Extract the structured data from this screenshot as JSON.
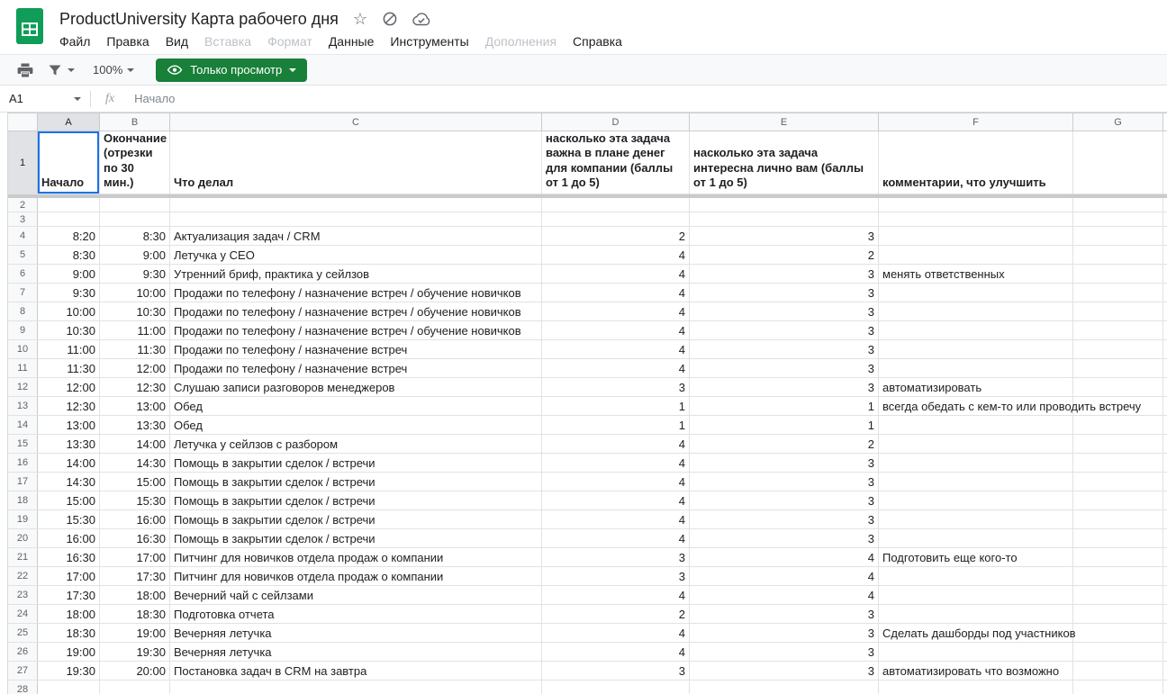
{
  "titlebar": {
    "title": "ProductUniversity Карта рабочего дня"
  },
  "glyphs": {
    "star": "☆"
  },
  "menus": [
    {
      "id": "file",
      "label": "Файл",
      "enabled": true
    },
    {
      "id": "edit",
      "label": "Правка",
      "enabled": true
    },
    {
      "id": "view",
      "label": "Вид",
      "enabled": true
    },
    {
      "id": "insert",
      "label": "Вставка",
      "enabled": false
    },
    {
      "id": "format",
      "label": "Формат",
      "enabled": false
    },
    {
      "id": "data",
      "label": "Данные",
      "enabled": true
    },
    {
      "id": "tools",
      "label": "Инструменты",
      "enabled": true
    },
    {
      "id": "addons",
      "label": "Дополнения",
      "enabled": false
    },
    {
      "id": "help",
      "label": "Справка",
      "enabled": true
    }
  ],
  "toolbar": {
    "zoom": "100%",
    "view_only": "Только просмотр"
  },
  "formula_bar": {
    "cell_ref": "A1",
    "fx_label": "fx",
    "value": "Начало"
  },
  "grid": {
    "column_letters": [
      "A",
      "B",
      "C",
      "D",
      "E",
      "F",
      "G"
    ],
    "selected_cell": "A1",
    "header_row": {
      "n": "1",
      "a": "Начало",
      "b": "Окончание (отрезки по 30 мин.)",
      "c": "Что делал",
      "d": "насколько эта задача важна в плане денег для компании (баллы от 1 до 5)",
      "e": "насколько эта задача интересна лично вам (баллы от 1 до 5)",
      "f": "комментарии, что улучшить",
      "g": ""
    },
    "rows": [
      {
        "n": "2",
        "a": "",
        "b": "",
        "c": "",
        "d": "",
        "e": "",
        "f": "",
        "g": ""
      },
      {
        "n": "3",
        "a": "",
        "b": "",
        "c": "",
        "d": "",
        "e": "",
        "f": "",
        "g": ""
      },
      {
        "n": "4",
        "a": "8:20",
        "b": "8:30",
        "c": "Актуализация задач / CRM",
        "d": "2",
        "e": "3",
        "f": "",
        "g": ""
      },
      {
        "n": "5",
        "a": "8:30",
        "b": "9:00",
        "c": "Летучка у CEO",
        "d": "4",
        "e": "2",
        "f": "",
        "g": ""
      },
      {
        "n": "6",
        "a": "9:00",
        "b": "9:30",
        "c": "Утренний бриф, практика у сейлзов",
        "d": "4",
        "e": "3",
        "f": "менять ответственных",
        "g": ""
      },
      {
        "n": "7",
        "a": "9:30",
        "b": "10:00",
        "c": "Продажи по телефону / назначение встреч / обучение новичков",
        "d": "4",
        "e": "3",
        "f": "",
        "g": ""
      },
      {
        "n": "8",
        "a": "10:00",
        "b": "10:30",
        "c": "Продажи по телефону / назначение встреч / обучение новичков",
        "d": "4",
        "e": "3",
        "f": "",
        "g": ""
      },
      {
        "n": "9",
        "a": "10:30",
        "b": "11:00",
        "c": "Продажи по телефону / назначение встреч / обучение новичков",
        "d": "4",
        "e": "3",
        "f": "",
        "g": ""
      },
      {
        "n": "10",
        "a": "11:00",
        "b": "11:30",
        "c": "Продажи по телефону / назначение встреч",
        "d": "4",
        "e": "3",
        "f": "",
        "g": ""
      },
      {
        "n": "11",
        "a": "11:30",
        "b": "12:00",
        "c": "Продажи по телефону / назначение встреч",
        "d": "4",
        "e": "3",
        "f": "",
        "g": ""
      },
      {
        "n": "12",
        "a": "12:00",
        "b": "12:30",
        "c": "Слушаю записи разговоров менеджеров",
        "d": "3",
        "e": "3",
        "f": "автоматизировать",
        "g": ""
      },
      {
        "n": "13",
        "a": "12:30",
        "b": "13:00",
        "c": "Обед",
        "d": "1",
        "e": "1",
        "f": "всегда обедать с кем-то или проводить встречу",
        "g": ""
      },
      {
        "n": "14",
        "a": "13:00",
        "b": "13:30",
        "c": "Обед",
        "d": "1",
        "e": "1",
        "f": "",
        "g": ""
      },
      {
        "n": "15",
        "a": "13:30",
        "b": "14:00",
        "c": "Летучка у сейлзов с разбором",
        "d": "4",
        "e": "2",
        "f": "",
        "g": ""
      },
      {
        "n": "16",
        "a": "14:00",
        "b": "14:30",
        "c": "Помощь в закрытии сделок / встречи",
        "d": "4",
        "e": "3",
        "f": "",
        "g": ""
      },
      {
        "n": "17",
        "a": "14:30",
        "b": "15:00",
        "c": "Помощь в закрытии сделок / встречи",
        "d": "4",
        "e": "3",
        "f": "",
        "g": ""
      },
      {
        "n": "18",
        "a": "15:00",
        "b": "15:30",
        "c": "Помощь в закрытии сделок / встречи",
        "d": "4",
        "e": "3",
        "f": "",
        "g": ""
      },
      {
        "n": "19",
        "a": "15:30",
        "b": "16:00",
        "c": "Помощь в закрытии сделок / встречи",
        "d": "4",
        "e": "3",
        "f": "",
        "g": ""
      },
      {
        "n": "20",
        "a": "16:00",
        "b": "16:30",
        "c": "Помощь в закрытии сделок / встречи",
        "d": "4",
        "e": "3",
        "f": "",
        "g": ""
      },
      {
        "n": "21",
        "a": "16:30",
        "b": "17:00",
        "c": "Питчинг для новичков отдела продаж о компании",
        "d": "3",
        "e": "4",
        "f": "Подготовить еще кого-то",
        "g": ""
      },
      {
        "n": "22",
        "a": "17:00",
        "b": "17:30",
        "c": "Питчинг для новичков отдела продаж о компании",
        "d": "3",
        "e": "4",
        "f": "",
        "g": ""
      },
      {
        "n": "23",
        "a": "17:30",
        "b": "18:00",
        "c": "Вечерний чай с сейлзами",
        "d": "4",
        "e": "4",
        "f": "",
        "g": ""
      },
      {
        "n": "24",
        "a": "18:00",
        "b": "18:30",
        "c": "Подготовка отчета",
        "d": "2",
        "e": "3",
        "f": "",
        "g": ""
      },
      {
        "n": "25",
        "a": "18:30",
        "b": "19:00",
        "c": "Вечерняя летучка",
        "d": "4",
        "e": "3",
        "f": "Сделать дашборды под участников",
        "g": ""
      },
      {
        "n": "26",
        "a": "19:00",
        "b": "19:30",
        "c": "Вечерняя летучка",
        "d": "4",
        "e": "3",
        "f": "",
        "g": ""
      },
      {
        "n": "27",
        "a": "19:30",
        "b": "20:00",
        "c": "Постановка задач в CRM на завтра",
        "d": "3",
        "e": "3",
        "f": "автоматизировать что возможно",
        "g": ""
      },
      {
        "n": "28",
        "a": "",
        "b": "",
        "c": "",
        "d": "",
        "e": "",
        "f": "",
        "g": ""
      }
    ]
  }
}
